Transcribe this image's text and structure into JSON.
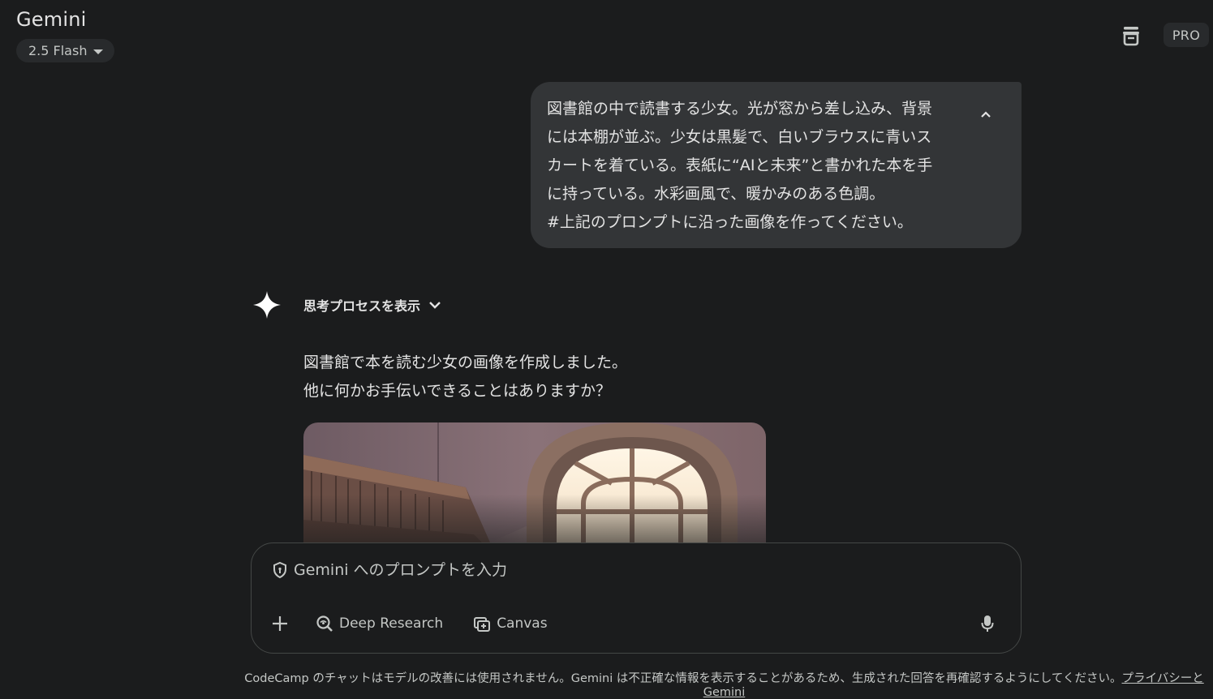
{
  "header": {
    "app_title": "Gemini",
    "model_label": "2.5 Flash",
    "pro_label": "PRO"
  },
  "user_message": {
    "text": "図書館の中で読書する少女。光が窓から差し込み、背景\nには本棚が並ぶ。少女は黒髪で、白いブラウスに青いス\nカートを着ている。表紙に“AIと未来”と書かれた本を手\nに持っている。水彩画風で、暖かみのある色調。\n#上記のプロンプトに沿った画像を作ってください。"
  },
  "response": {
    "thinking_label": "思考プロセスを表示",
    "line1": "図書館で本を読む少女の画像を作成しました。",
    "line2": "他に何かお手伝いできることはありますか？"
  },
  "input": {
    "placeholder": "Gemini へのプロンプトを入力",
    "value": "",
    "tools": {
      "deep_research": "Deep Research",
      "canvas": "Canvas"
    }
  },
  "footer": {
    "notice": "CodeCamp のチャットはモデルの改善には使用されません。Gemini は不正確な情報を表示することがあるため、生成された回答を再確認するようにしてください。",
    "privacy_link": "プライバシーと Gemini"
  },
  "icons": {
    "trash": "delete-icon",
    "collapse": "chevron-up-icon",
    "sparkle": "gemini-sparkle-icon",
    "expand": "chevron-down-icon",
    "shield": "shield-icon",
    "plus": "plus-icon",
    "deep_research": "deep-research-icon",
    "canvas": "canvas-icon",
    "mic": "mic-icon"
  },
  "colors": {
    "background": "#1b1c1d",
    "bubble": "#333537",
    "chip": "#282a2c",
    "text": "#e3e3e3",
    "muted": "#c4c7c5"
  }
}
